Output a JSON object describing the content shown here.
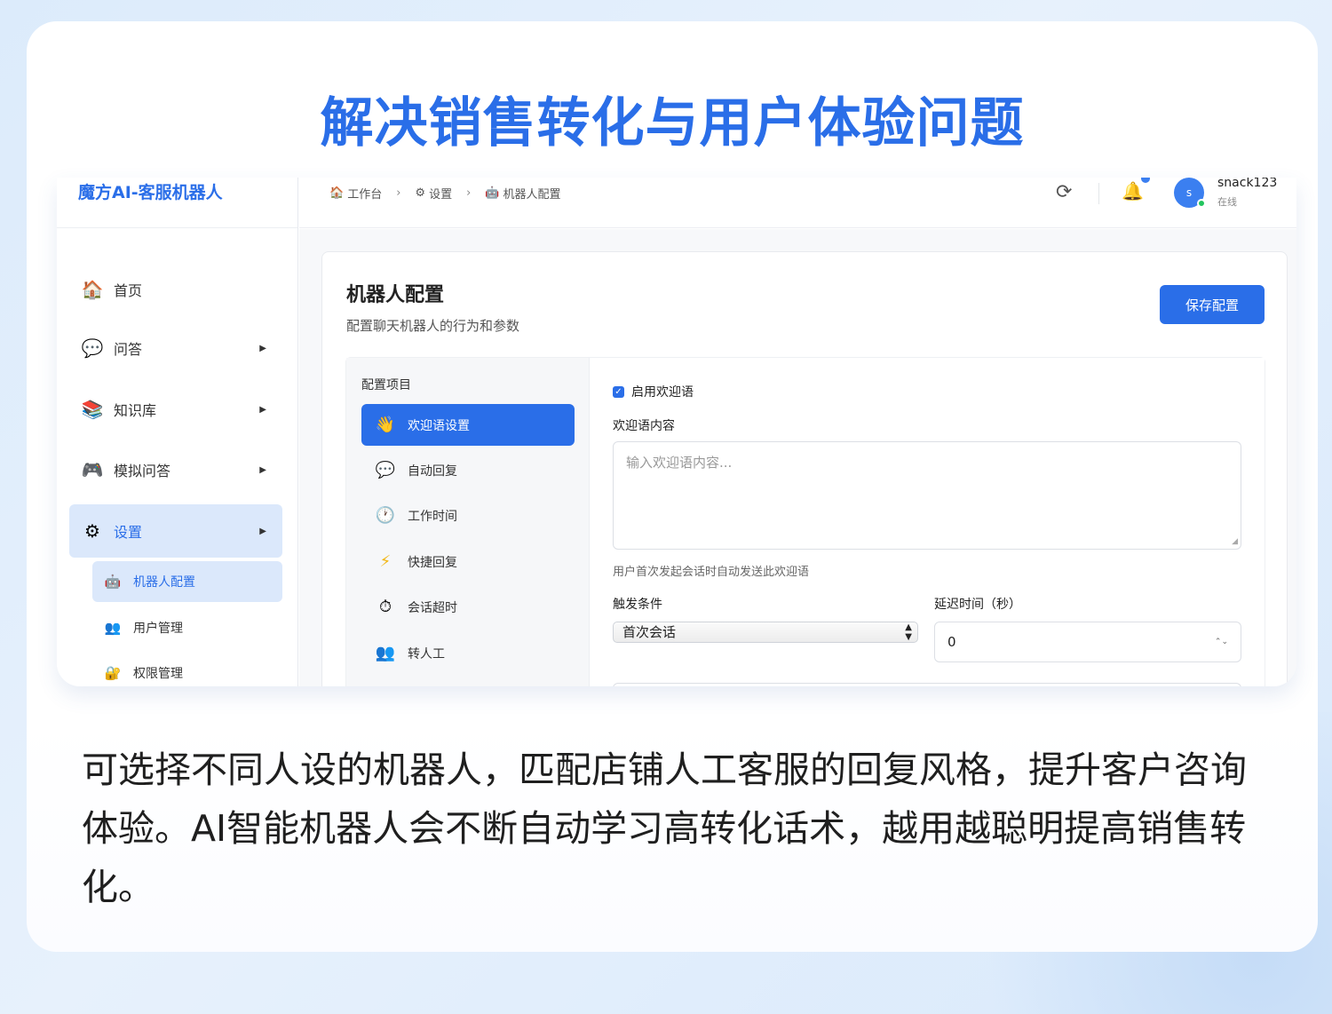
{
  "headline": "解决销售转化与用户体验问题",
  "app": {
    "brand": "魔方AI-客服机器人",
    "sidebar": {
      "items": [
        {
          "label": "首页",
          "icon": "house-icon",
          "glyph": "🏠",
          "arrow": ""
        },
        {
          "label": "问答",
          "icon": "speech-bubble-icon",
          "glyph": "💬",
          "arrow": "▶"
        },
        {
          "label": "知识库",
          "icon": "books-icon",
          "glyph": "📚",
          "arrow": "▶"
        },
        {
          "label": "模拟问答",
          "icon": "gamepad-icon",
          "glyph": "🎮",
          "arrow": "▶"
        },
        {
          "label": "设置",
          "icon": "gear-icon",
          "glyph": "⚙",
          "arrow": "▶"
        }
      ],
      "subitems": [
        {
          "label": "机器人配置",
          "icon": "robot-icon",
          "glyph": "🤖"
        },
        {
          "label": "用户管理",
          "icon": "users-icon",
          "glyph": "👥"
        },
        {
          "label": "权限管理",
          "icon": "lock-icon",
          "glyph": "🔐"
        }
      ]
    },
    "breadcrumb": [
      {
        "label": "工作台",
        "glyph": "🏠"
      },
      {
        "label": "设置",
        "glyph": "⚙"
      },
      {
        "label": "机器人配置",
        "glyph": "🤖"
      }
    ],
    "breadcrumb_sep": "›",
    "user": {
      "initial": "s",
      "name": "snack123",
      "status": "在线"
    },
    "panel": {
      "title": "机器人配置",
      "subtitle": "配置聊天机器人的行为和参数",
      "save_label": "保存配置",
      "menu_header": "配置项目",
      "menu": [
        {
          "label": "欢迎语设置",
          "icon": "waving-hand-icon",
          "glyph": "👋"
        },
        {
          "label": "自动回复",
          "icon": "speech-bubble-icon",
          "glyph": "💬"
        },
        {
          "label": "工作时间",
          "icon": "clock-icon",
          "glyph": "🕐"
        },
        {
          "label": "快捷回复",
          "icon": "lightning-icon",
          "glyph": "⚡"
        },
        {
          "label": "会话超时",
          "icon": "stopwatch-icon",
          "glyph": "⏱"
        },
        {
          "label": "转人工",
          "icon": "users-icon",
          "glyph": "👥"
        }
      ],
      "form": {
        "enable_label": "启用欢迎语",
        "content_label": "欢迎语内容",
        "content_placeholder": "输入欢迎语内容...",
        "hint": "用户首次发起会话时自动发送此欢迎语",
        "trigger_label": "触发条件",
        "trigger_value": "首次会话",
        "delay_label": "延迟时间（秒）",
        "delay_value": "0"
      }
    }
  },
  "description": "可选择不同人设的机器人，匹配店铺人工客服的回复风格，提升客户咨询体验。AI智能机器人会不断自动学习高转化话术，越用越聪明提高销售转化。",
  "colors": {
    "accent": "#2a6ee8",
    "online": "#22c55e",
    "bell": "#f2b614"
  }
}
